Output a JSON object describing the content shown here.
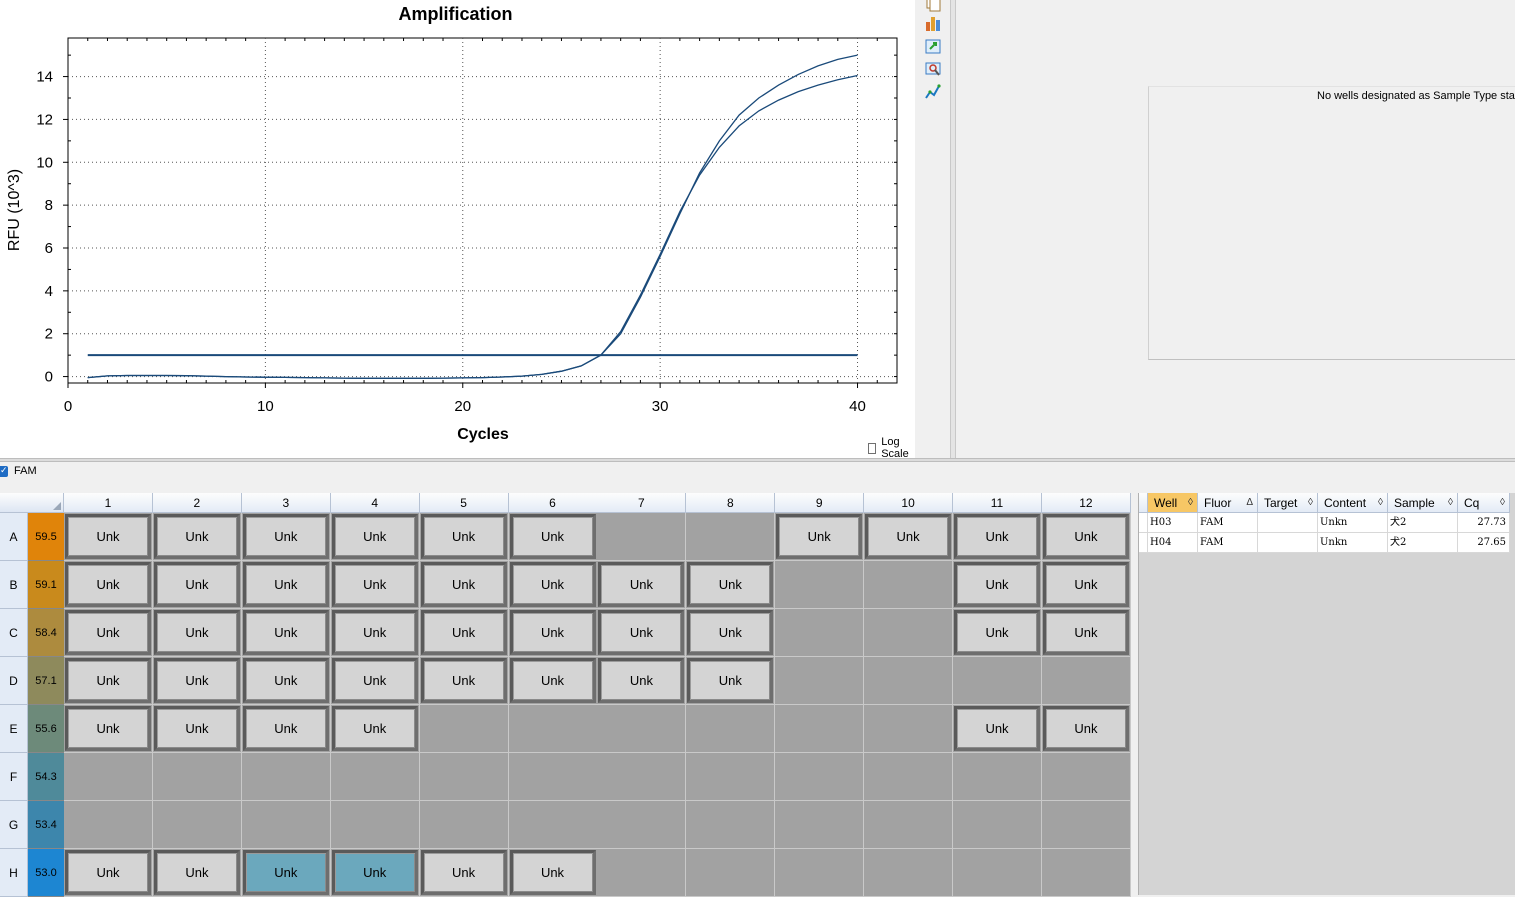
{
  "chart": {
    "log_scale_label": "Log Scale",
    "log_scale_checked": false
  },
  "chart_data": {
    "type": "line",
    "title": "Amplification",
    "xlabel": "Cycles",
    "ylabel": "RFU (10^3)",
    "xlim": [
      0,
      42
    ],
    "ylim": [
      -0.3,
      15.8
    ],
    "xticks": [
      0,
      10,
      20,
      30,
      40
    ],
    "yticks": [
      0,
      2,
      4,
      6,
      8,
      10,
      12,
      14
    ],
    "grid": true,
    "threshold": 1.0,
    "series": [
      {
        "color": "#1a4a7a",
        "x": [
          1,
          2,
          3,
          4,
          5,
          6,
          7,
          8,
          9,
          10,
          11,
          12,
          13,
          14,
          15,
          16,
          17,
          18,
          19,
          20,
          21,
          22,
          23,
          24,
          25,
          26,
          27,
          28,
          29,
          30,
          31,
          32,
          33,
          34,
          35,
          36,
          37,
          38,
          39,
          40
        ],
        "y": [
          -0.05,
          0.03,
          0.05,
          0.05,
          0.05,
          0.04,
          0.02,
          0.0,
          -0.02,
          -0.03,
          -0.04,
          -0.05,
          -0.06,
          -0.07,
          -0.08,
          -0.08,
          -0.08,
          -0.08,
          -0.07,
          -0.06,
          -0.05,
          -0.02,
          0.02,
          0.1,
          0.25,
          0.5,
          1.0,
          2.0,
          3.7,
          5.6,
          7.6,
          9.5,
          11.0,
          12.2,
          13.0,
          13.6,
          14.1,
          14.5,
          14.8,
          15.0
        ]
      },
      {
        "color": "#1a4a7a",
        "x": [
          1,
          2,
          3,
          4,
          5,
          6,
          7,
          8,
          9,
          10,
          11,
          12,
          13,
          14,
          15,
          16,
          17,
          18,
          19,
          20,
          21,
          22,
          23,
          24,
          25,
          26,
          27,
          28,
          29,
          30,
          31,
          32,
          33,
          34,
          35,
          36,
          37,
          38,
          39,
          40
        ],
        "y": [
          -0.05,
          0.03,
          0.05,
          0.05,
          0.05,
          0.04,
          0.02,
          0.0,
          -0.02,
          -0.03,
          -0.04,
          -0.05,
          -0.06,
          -0.07,
          -0.08,
          -0.08,
          -0.08,
          -0.08,
          -0.07,
          -0.06,
          -0.05,
          -0.02,
          0.02,
          0.1,
          0.25,
          0.5,
          1.0,
          2.1,
          3.8,
          5.7,
          7.7,
          9.4,
          10.7,
          11.7,
          12.4,
          12.9,
          13.3,
          13.6,
          13.85,
          14.05
        ]
      }
    ]
  },
  "toolbar_icons": [
    "copy-icon",
    "chart-settings-icon",
    "export-icon",
    "zoom-icon",
    "trace-styles-icon"
  ],
  "standard_curve": {
    "message": "No wells designated as Sample Type stanc"
  },
  "fluor_filter": {
    "label": "FAM",
    "checked": true
  },
  "plate": {
    "columns": [
      "1",
      "2",
      "3",
      "4",
      "5",
      "6",
      "7",
      "8",
      "9",
      "10",
      "11",
      "12"
    ],
    "rows": [
      {
        "label": "A",
        "temp": "59.5",
        "temp_color": "#e0840a",
        "wells": [
          "Unk",
          "Unk",
          "Unk",
          "Unk",
          "Unk",
          "Unk",
          "",
          "",
          "Unk",
          "Unk",
          "Unk",
          "Unk"
        ]
      },
      {
        "label": "B",
        "temp": "59.1",
        "temp_color": "#c98a1c",
        "wells": [
          "Unk",
          "Unk",
          "Unk",
          "Unk",
          "Unk",
          "Unk",
          "Unk",
          "Unk",
          "",
          "",
          "Unk",
          "Unk"
        ]
      },
      {
        "label": "C",
        "temp": "58.4",
        "temp_color": "#ad8b3e",
        "wells": [
          "Unk",
          "Unk",
          "Unk",
          "Unk",
          "Unk",
          "Unk",
          "Unk",
          "Unk",
          "",
          "",
          "Unk",
          "Unk"
        ]
      },
      {
        "label": "D",
        "temp": "57.1",
        "temp_color": "#8e8a5c",
        "wells": [
          "Unk",
          "Unk",
          "Unk",
          "Unk",
          "Unk",
          "Unk",
          "Unk",
          "Unk",
          "",
          "",
          "",
          ""
        ]
      },
      {
        "label": "E",
        "temp": "55.6",
        "temp_color": "#6d8a7a",
        "wells": [
          "Unk",
          "Unk",
          "Unk",
          "Unk",
          "",
          "",
          "",
          "",
          "",
          "",
          "Unk",
          "Unk"
        ]
      },
      {
        "label": "F",
        "temp": "54.3",
        "temp_color": "#4f8a9a",
        "wells": [
          "",
          "",
          "",
          "",
          "",
          "",
          "",
          "",
          "",
          "",
          "",
          ""
        ]
      },
      {
        "label": "G",
        "temp": "53.4",
        "temp_color": "#3d86ac",
        "wells": [
          "",
          "",
          "",
          "",
          "",
          "",
          "",
          "",
          "",
          "",
          "",
          ""
        ]
      },
      {
        "label": "H",
        "temp": "53.0",
        "temp_color": "#1d86d2",
        "wells": [
          "Unk",
          "Unk",
          "Unk",
          "Unk",
          "Unk",
          "Unk",
          "",
          "",
          "",
          "",
          "",
          ""
        ]
      }
    ],
    "selected_wells": [
      "H3",
      "H4"
    ]
  },
  "results_table": {
    "columns": [
      "Well",
      "Fluor",
      "Target",
      "Content",
      "Sample",
      "Cq"
    ],
    "sort_glyphs": [
      "◊",
      "Δ",
      "◊",
      "◊",
      "◊",
      "◊"
    ],
    "rows": [
      {
        "Well": "H03",
        "Fluor": "FAM",
        "Target": "",
        "Content": "Unkn",
        "Sample": "犬2",
        "Cq": "27.73"
      },
      {
        "Well": "H04",
        "Fluor": "FAM",
        "Target": "",
        "Content": "Unkn",
        "Sample": "犬2",
        "Cq": "27.65"
      }
    ]
  }
}
